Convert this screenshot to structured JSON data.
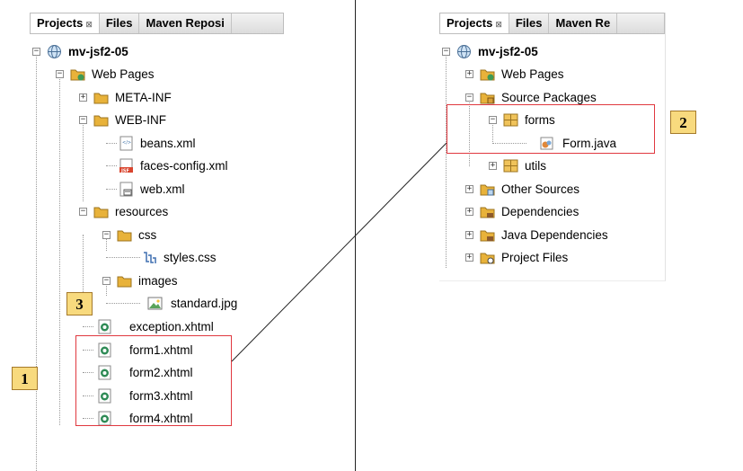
{
  "left_panel": {
    "tabs": [
      {
        "label": "Projects",
        "close": "⊠"
      },
      {
        "label": "Files"
      },
      {
        "label": "Maven Reposi"
      }
    ],
    "tree": {
      "project": "mv-jsf2-05",
      "web_pages": "Web Pages",
      "meta_inf": "META-INF",
      "web_inf": "WEB-INF",
      "beans_xml": "beans.xml",
      "faces_config_xml": "faces-config.xml",
      "web_xml": "web.xml",
      "resources": "resources",
      "css": "css",
      "styles_css": "styles.css",
      "images": "images",
      "standard_jpg": "standard.jpg",
      "exception_xhtml": "exception.xhtml",
      "form1": "form1.xhtml",
      "form2": "form2.xhtml",
      "form3": "form3.xhtml",
      "form4": "form4.xhtml"
    }
  },
  "right_panel": {
    "tabs": [
      {
        "label": "Projects",
        "close": "⊠"
      },
      {
        "label": "Files"
      },
      {
        "label": "Maven Re"
      }
    ],
    "tree": {
      "project": "mv-jsf2-05",
      "web_pages": "Web Pages",
      "source_packages": "Source Packages",
      "forms": "forms",
      "form_java": "Form.java",
      "utils": "utils",
      "other_sources": "Other Sources",
      "dependencies": "Dependencies",
      "java_dependencies": "Java Dependencies",
      "project_files": "Project Files"
    }
  },
  "annotations": {
    "badge_1": "1",
    "badge_2": "2",
    "badge_3": "3"
  },
  "colors": {
    "highlight_border": "#e0383f",
    "badge_fill": "#f8da7e",
    "folder": "#e8b23a"
  }
}
